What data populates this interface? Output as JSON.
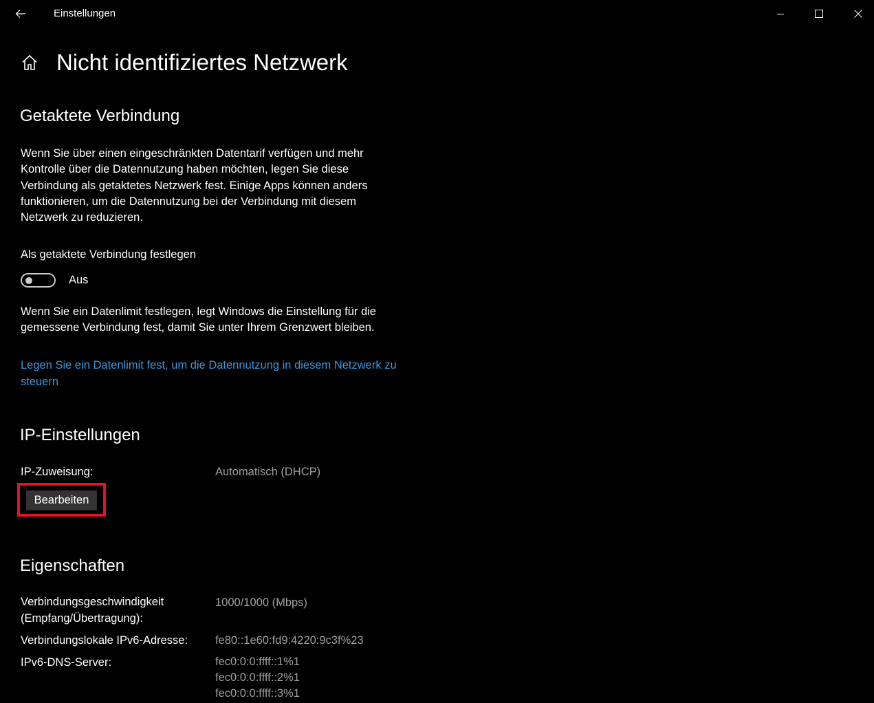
{
  "window": {
    "app_title": "Einstellungen",
    "back_icon": "back-arrow-icon",
    "minimize_icon": "minimize-icon",
    "maximize_icon": "maximize-icon",
    "close_icon": "close-icon"
  },
  "header": {
    "home_icon": "home-icon",
    "title": "Nicht identifiziertes Netzwerk"
  },
  "metered": {
    "section_title": "Getaktete Verbindung",
    "description": "Wenn Sie über einen eingeschränkten Datentarif verfügen und mehr Kontrolle über die Datennutzung haben möchten, legen Sie diese Verbindung als getaktetes Netzwerk fest. Einige Apps können anders funktionieren, um die Datennutzung bei der Verbindung mit diesem Netzwerk zu reduzieren.",
    "toggle_label": "Als getaktete Verbindung festlegen",
    "toggle_state": "Aus",
    "toggle_on": false,
    "limit_note": "Wenn Sie ein Datenlimit festlegen, legt Windows die Einstellung für die gemessene Verbindung fest, damit Sie unter Ihrem Grenzwert bleiben.",
    "limit_link": "Legen Sie ein Datenlimit fest, um die Datennutzung in diesem Netzwerk zu steuern"
  },
  "ip_settings": {
    "section_title": "IP-Einstellungen",
    "assignment_label": "IP-Zuweisung:",
    "assignment_value": "Automatisch (DHCP)",
    "edit_button": "Bearbeiten"
  },
  "properties": {
    "section_title": "Eigenschaften",
    "speed_label_line1": "Verbindungsgeschwindigkeit",
    "speed_label_line2": "(Empfang/Übertragung):",
    "speed_value": "1000/1000 (Mbps)",
    "ipv6_local_label": "Verbindungslokale IPv6-Adresse:",
    "ipv6_local_value": "fe80::1e60:fd9:4220:9c3f%23",
    "ipv6_dns_label": "IPv6-DNS-Server:",
    "ipv6_dns_values": [
      "fec0:0:0:ffff::1%1",
      "fec0:0:0:ffff::2%1",
      "fec0:0:0:ffff::3%1"
    ]
  },
  "colors": {
    "background": "#000000",
    "text": "#ffffff",
    "secondary_text": "#a0a0a0",
    "link": "#3a96dd",
    "highlight_frame": "#e81123",
    "button_bg": "#333333"
  }
}
